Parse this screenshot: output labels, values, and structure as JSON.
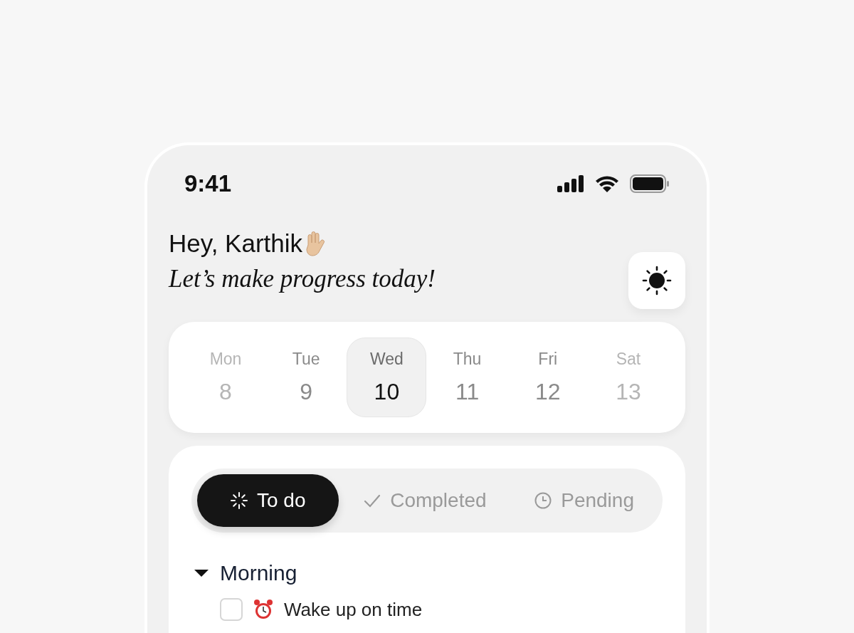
{
  "status_bar": {
    "time": "9:41"
  },
  "header": {
    "greeting": "Hey, Karthik",
    "subtitle": "Let’s make progress today!"
  },
  "days": [
    {
      "name": "Mon",
      "date": "8",
      "selected": false,
      "dimmed": true
    },
    {
      "name": "Tue",
      "date": "9",
      "selected": false,
      "dimmed": false
    },
    {
      "name": "Wed",
      "date": "10",
      "selected": true,
      "dimmed": false
    },
    {
      "name": "Thu",
      "date": "11",
      "selected": false,
      "dimmed": false
    },
    {
      "name": "Fri",
      "date": "12",
      "selected": false,
      "dimmed": false
    },
    {
      "name": "Sat",
      "date": "13",
      "selected": false,
      "dimmed": true
    }
  ],
  "tabs": [
    {
      "label": "To do",
      "kind": "todo",
      "selected": true
    },
    {
      "label": "Completed",
      "kind": "completed",
      "selected": false
    },
    {
      "label": "Pending",
      "kind": "pending",
      "selected": false
    }
  ],
  "sections": [
    {
      "title": "Morning",
      "expanded": true,
      "tasks": [
        {
          "label": "Wake up on time",
          "checked": false
        }
      ]
    }
  ]
}
